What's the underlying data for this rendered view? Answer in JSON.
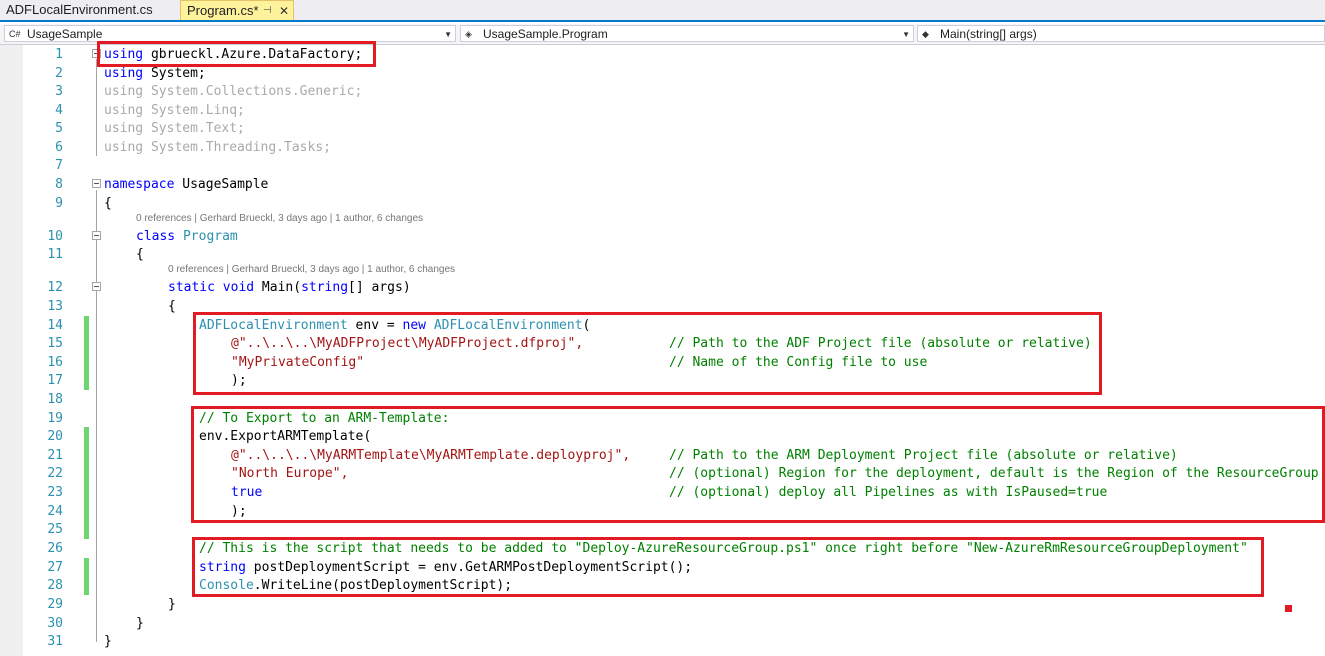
{
  "tabs": [
    {
      "label": "ADFLocalEnvironment.cs",
      "active": false
    },
    {
      "label": "Program.cs*",
      "active": true,
      "pin": "⊣",
      "close": "✕"
    }
  ],
  "nav": {
    "project": "UsageSample",
    "class": "UsageSample.Program",
    "member": "Main(string[] args)"
  },
  "lens": {
    "class": "0 references | Gerhard Brueckl, 3 days ago | 1 author, 6 changes",
    "method": "0 references | Gerhard Brueckl, 3 days ago | 1 author, 6 changes"
  },
  "lines": [
    {
      "n": "1",
      "t": "using gbrueckl.Azure.DataFactory;"
    },
    {
      "n": "2",
      "t": "using System;"
    },
    {
      "n": "3",
      "t": "using System.Collections.Generic;"
    },
    {
      "n": "4",
      "t": "using System.Linq;"
    },
    {
      "n": "5",
      "t": "using System.Text;"
    },
    {
      "n": "6",
      "t": "using System.Threading.Tasks;"
    },
    {
      "n": "7",
      "t": ""
    },
    {
      "n": "8",
      "t": "namespace UsageSample"
    },
    {
      "n": "9",
      "t": "{"
    },
    {
      "n": "10",
      "t": "class Program"
    },
    {
      "n": "11",
      "t": "{"
    },
    {
      "n": "12",
      "t": "static void Main(string[] args)"
    },
    {
      "n": "13",
      "t": "{"
    },
    {
      "n": "14",
      "t": "ADFLocalEnvironment env = new ADFLocalEnvironment("
    },
    {
      "n": "15",
      "t": "@\"..\\..\\..\\MyADFProject\\MyADFProject.dfproj\",",
      "c": "// Path to the ADF Project file (absolute or relative)"
    },
    {
      "n": "16",
      "t": "\"MyPrivateConfig\"",
      "c": "// Name of the Config file to use"
    },
    {
      "n": "17",
      "t": ");"
    },
    {
      "n": "18",
      "t": ""
    },
    {
      "n": "19",
      "t": "// To Export to an ARM-Template:"
    },
    {
      "n": "20",
      "t": "env.ExportARMTemplate("
    },
    {
      "n": "21",
      "t": "@\"..\\..\\..\\MyARMTemplate\\MyARMTemplate.deployproj\",",
      "c": "// Path to the ARM Deployment Project file (absolute or relative)"
    },
    {
      "n": "22",
      "t": "\"North Europe\",",
      "c": "// (optional) Region for the deployment, default is the Region of the ResourceGroup"
    },
    {
      "n": "23",
      "t": "true",
      "c": "// (optional) deploy all Pipelines as with IsPaused=true"
    },
    {
      "n": "24",
      "t": ");"
    },
    {
      "n": "25",
      "t": ""
    },
    {
      "n": "26",
      "t": "// This is the script that needs to be added to \"Deploy-AzureResourceGroup.ps1\" once right before \"New-AzureRmResourceGroupDeployment\""
    },
    {
      "n": "27",
      "t": "string postDeploymentScript = env.GetARMPostDeploymentScript();"
    },
    {
      "n": "28",
      "t": "Console.WriteLine(postDeploymentScript);"
    },
    {
      "n": "29",
      "t": "}"
    },
    {
      "n": "30",
      "t": "}"
    },
    {
      "n": "31",
      "t": "}"
    }
  ],
  "colors": {
    "keyword": "#0000ff",
    "type": "#2b91af",
    "string": "#a31515",
    "comment": "#008000",
    "highlight": "#e21b23"
  }
}
